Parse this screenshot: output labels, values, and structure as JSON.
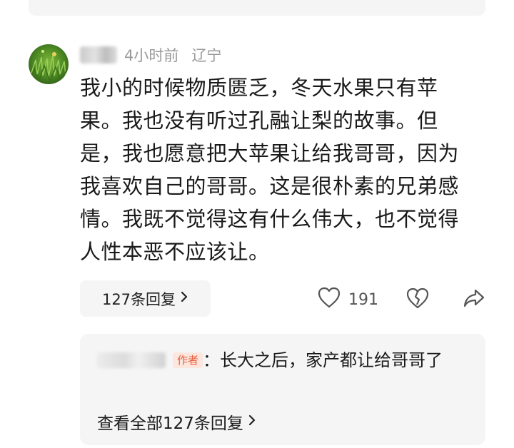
{
  "comment": {
    "meta": {
      "time": "4小时前",
      "location": "辽宁"
    },
    "text": "我小的时候物质匮乏，冬天水果只有苹果。我也没有听过孔融让梨的故事。但是，我也愿意把大苹果让给我哥哥，因为我喜欢自己的哥哥。这是很朴素的兄弟感情。我既不觉得这有什么伟大，也不觉得人性本恶不应该让。",
    "reply_count_label": "127条回复",
    "like_count": "191",
    "icons": {
      "like": "heart-icon",
      "dislike": "broken-heart-icon",
      "share": "share-icon",
      "chevron": "chevron-right-icon"
    }
  },
  "reply": {
    "author_badge": "作者",
    "text": "长大之后，家产都让给哥哥了",
    "view_all_label": "查看全部127条回复"
  },
  "colors": {
    "background": "#ffffff",
    "reply_bg": "#f5f5f5",
    "meta_text": "#999999",
    "badge_text": "#e85d3c",
    "badge_bg": "#fde6dd"
  }
}
